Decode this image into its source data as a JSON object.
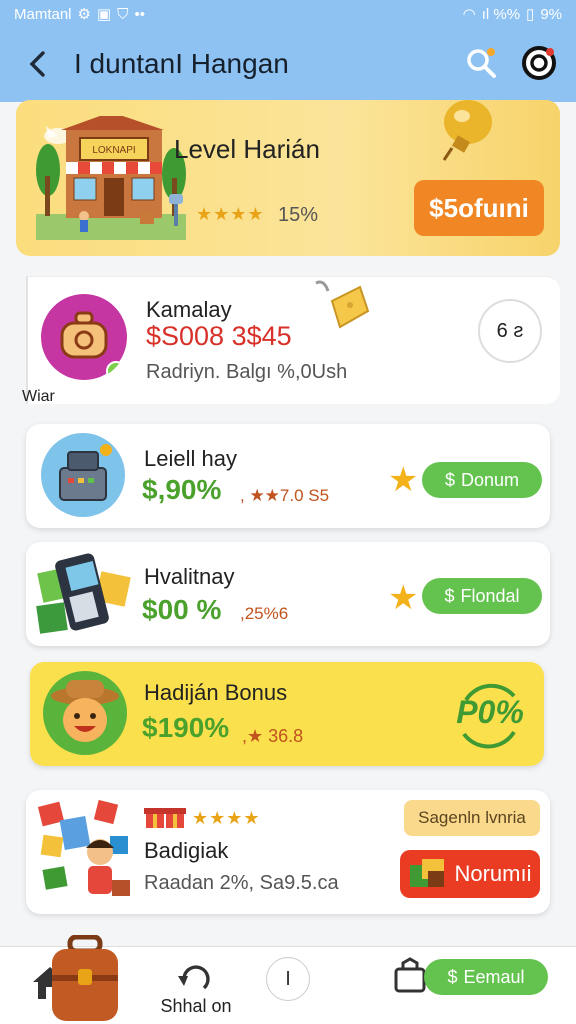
{
  "status_bar": {
    "left_text": "Mamtanl",
    "right_text": "ıl %%",
    "battery": "9%"
  },
  "header": {
    "title": "I duntanI Hangan"
  },
  "hero": {
    "title": "Level Harián",
    "stars": "★★★★",
    "percent": "15%",
    "button_label": "$5ofuıni",
    "shop_sign": "LOKNAPI"
  },
  "cards": [
    {
      "title": "Kamalay",
      "amount": "$S008 3$45",
      "subtitle": "Radriyn. Balgı %,0Ush",
      "action_label": "6 ƨ",
      "amount_color": "#d8312a"
    },
    {
      "title": "Leiell hay",
      "amount": "$,90%",
      "extra": ", ★★7.0 S5",
      "button_label": "Donum",
      "amount_color": "#4aa12c"
    },
    {
      "title": "Hvalitnay",
      "amount": "$00 %",
      "extra": ",25%6",
      "button_label": "Flondal",
      "amount_color": "#4aa12c"
    },
    {
      "title": "Hadiján Bonus",
      "amount": "$190%",
      "extra": ",★ 36.8",
      "badge": "P0%",
      "amount_color": "#4aa12c"
    },
    {
      "title": "Badigiak",
      "subtitle": "Raadan 2%, Sa9.5.ca",
      "stars": "★★★★",
      "tag_label": "Sagenln lvnria",
      "button_label": "Norumıi"
    }
  ],
  "side_label": "Wiar",
  "bottom_nav": {
    "center_label": "Shhal on",
    "circle_label": "I",
    "pill_label": "Eemaul"
  },
  "colors": {
    "header_bg": "#8ec2f3",
    "accent_orange": "#f08724",
    "accent_green": "#64c34e",
    "accent_red": "#ea3b23",
    "hero_bg": "#fbdd7d",
    "yellow_card": "#fbe04d"
  }
}
